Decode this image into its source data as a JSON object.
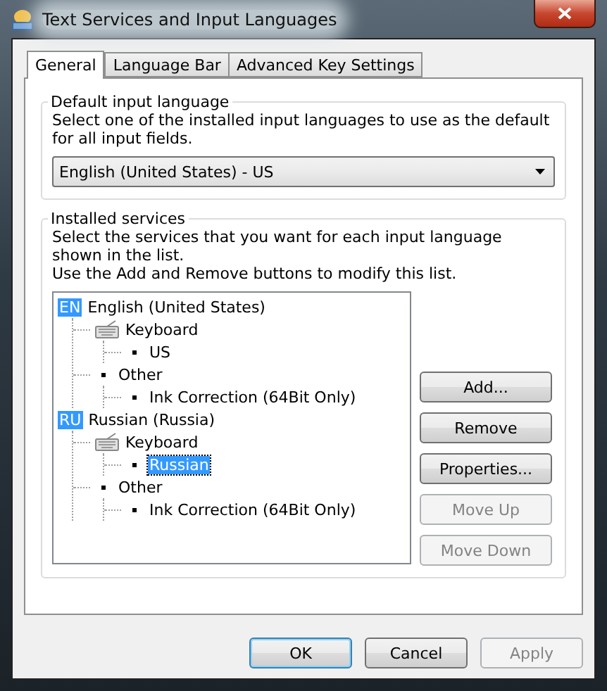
{
  "window": {
    "title": "Text Services and Input Languages"
  },
  "tabs": [
    {
      "label": "General",
      "selected": true
    },
    {
      "label": "Language Bar",
      "selected": false
    },
    {
      "label": "Advanced Key Settings",
      "selected": false
    }
  ],
  "default_input_language": {
    "title": "Default input language",
    "description": "Select one of the installed input languages to use as the default for all input fields.",
    "dropdown": {
      "value": "English (United States) - US"
    }
  },
  "installed_services": {
    "title": "Installed services",
    "description": "Select the services that you want for each input language shown in the list.\nUse the Add and Remove buttons to modify this list.",
    "tree": [
      {
        "kind": "language",
        "badge": "EN",
        "label": "English (United States)",
        "selected": false,
        "children": [
          {
            "kind": "keyboard",
            "label": "Keyboard",
            "selected": false,
            "children": [
              {
                "kind": "item",
                "label": "US",
                "selected": false
              }
            ]
          },
          {
            "kind": "item",
            "label": "Other",
            "selected": false,
            "children": [
              {
                "kind": "item",
                "label": "Ink Correction (64Bit Only)",
                "selected": false
              }
            ]
          }
        ]
      },
      {
        "kind": "language",
        "badge": "RU",
        "label": "Russian (Russia)",
        "selected": false,
        "children": [
          {
            "kind": "keyboard",
            "label": "Keyboard",
            "selected": false,
            "children": [
              {
                "kind": "item",
                "label": "Russian",
                "selected": true
              }
            ]
          },
          {
            "kind": "item",
            "label": "Other",
            "selected": false,
            "children": [
              {
                "kind": "item",
                "label": "Ink Correction (64Bit Only)",
                "selected": false
              }
            ]
          }
        ]
      }
    ],
    "buttons": [
      {
        "label": "Add...",
        "disabled": false
      },
      {
        "label": "Remove",
        "disabled": false
      },
      {
        "label": "Properties...",
        "disabled": false
      },
      {
        "label": "Move Up",
        "disabled": true
      },
      {
        "label": "Move Down",
        "disabled": true
      }
    ]
  },
  "footer_buttons": [
    {
      "label": "OK",
      "disabled": false,
      "default": true
    },
    {
      "label": "Cancel",
      "disabled": false,
      "default": false
    },
    {
      "label": "Apply",
      "disabled": true,
      "default": false
    }
  ]
}
